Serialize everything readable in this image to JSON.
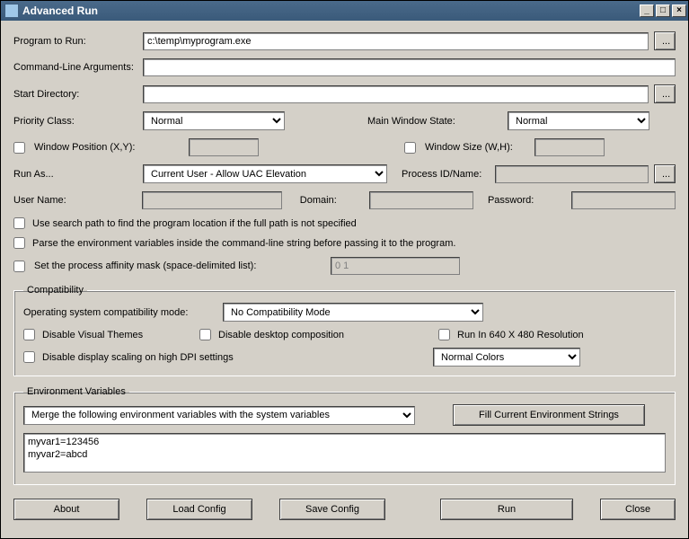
{
  "window": {
    "title": "Advanced Run"
  },
  "winbtns": {
    "min": "_",
    "max": "□",
    "close": "×"
  },
  "labels": {
    "program": "Program to Run:",
    "cmdline": "Command-Line Arguments:",
    "startdir": "Start Directory:",
    "priority": "Priority Class:",
    "mainwin": "Main Window State:",
    "winpos": "Window Position (X,Y):",
    "winsize": "Window Size (W,H):",
    "runas": "Run As...",
    "procid": "Process ID/Name:",
    "username": "User Name:",
    "domain": "Domain:",
    "password": "Password:",
    "searchpath": "Use search path to find the program location if the full path is not specified",
    "parseenv": "Parse the environment variables inside the command-line string before passing it to the program.",
    "affinity": "Set the process affinity mask (space-delimited list):",
    "compat": "Compatibility",
    "oscompat": "Operating system compatibility mode:",
    "disthemes": "Disable Visual Themes",
    "disdesktop": "Disable desktop composition",
    "run640": "Run In 640 X 480 Resolution",
    "disdpi": "Disable display scaling on high DPI settings",
    "envvars": "Environment Variables",
    "fillenv": "Fill Current Environment Strings",
    "about": "About",
    "loadcfg": "Load Config",
    "savecfg": "Save Config",
    "run": "Run",
    "closebtn": "Close",
    "browse": "..."
  },
  "values": {
    "program": "c:\\temp\\myprogram.exe",
    "cmdline": "",
    "startdir": "",
    "priority": "Normal",
    "mainwin": "Normal",
    "winpos": "",
    "winsize": "",
    "runas": "Current User - Allow UAC Elevation",
    "procid": "",
    "username": "",
    "domain": "",
    "password": "",
    "affinity": "0 1",
    "oscompat": "No Compatibility Mode",
    "colors": "Normal Colors",
    "envmode": "Merge the following environment variables with the system variables",
    "envtext": "myvar1=123456\nmyvar2=abcd"
  }
}
